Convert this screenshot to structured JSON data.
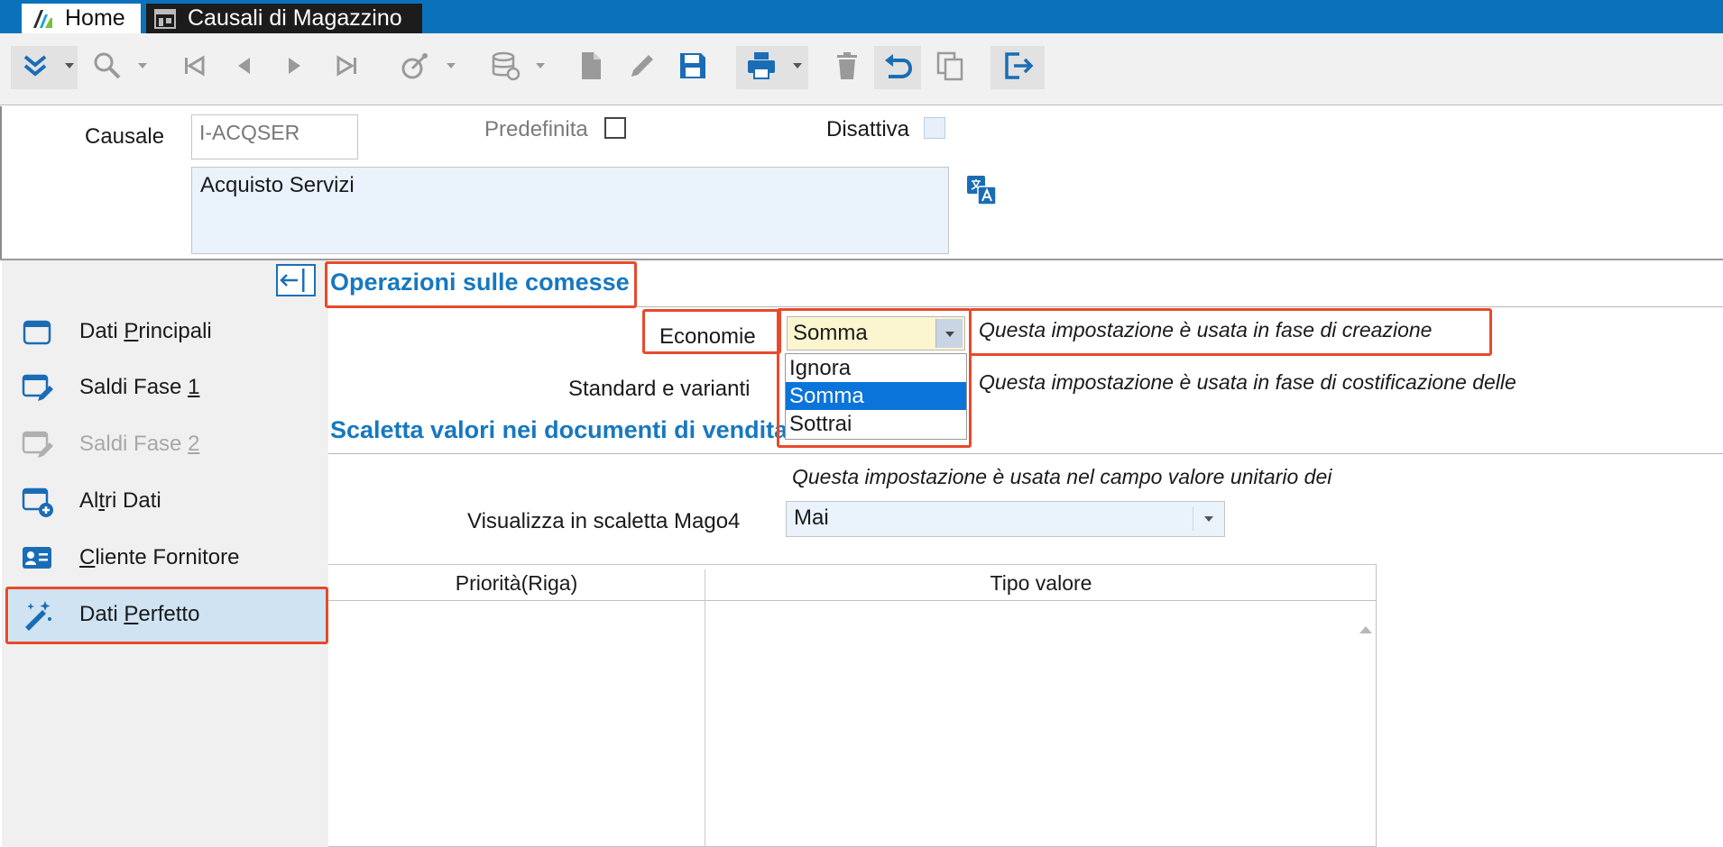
{
  "tabs": [
    {
      "label": "Home"
    },
    {
      "label": "Causali di Magazzino"
    }
  ],
  "form": {
    "causale_label": "Causale",
    "causale_value": "I-ACQSER",
    "predefinita_label": "Predefinita",
    "predefinita_checked": false,
    "disattiva_label": "Disattiva",
    "disattiva_checked": false,
    "description": "Acquisto Servizi"
  },
  "sidebar": {
    "items": [
      {
        "pre": "Dati ",
        "key": "P",
        "post": "rincipali",
        "icon": "card-icon",
        "state": "normal"
      },
      {
        "pre": "Saldi Fase ",
        "key": "1",
        "post": "",
        "icon": "edit-card-icon",
        "state": "normal"
      },
      {
        "pre": "Saldi Fase ",
        "key": "2",
        "post": "",
        "icon": "edit-card-icon",
        "state": "disabled"
      },
      {
        "pre": "Al",
        "key": "t",
        "post": "ri Dati",
        "icon": "add-card-icon",
        "state": "normal"
      },
      {
        "pre": "",
        "key": "C",
        "post": "liente Fornitore",
        "icon": "contact-card-icon",
        "state": "normal"
      },
      {
        "pre": "Dati ",
        "key": "P",
        "post": "erfetto",
        "icon": "magic-wand-icon",
        "state": "active"
      }
    ]
  },
  "main": {
    "section1_title": "Operazioni sulle comesse",
    "economie_label": "Economie",
    "economie_value": "Somma",
    "economie_hint": "Questa impostazione è usata in fase di creazione",
    "standard_label": "Standard e varianti",
    "standard_hint": "Questa impostazione è usata in fase di costificazione delle",
    "dropdown_options": [
      {
        "label": "Ignora",
        "selected": false
      },
      {
        "label": "Somma",
        "selected": true
      },
      {
        "label": "Sottrai",
        "selected": false
      }
    ],
    "section2_title": "Scaletta valori nei documenti di vendita",
    "scaletta_hint": "Questa impostazione è usata nel campo valore unitario dei",
    "scaletta_label": "Visualizza in scaletta Mago4",
    "scaletta_value": "Mai",
    "grid_headers": [
      "Priorità(Riga)",
      "Tipo valore"
    ]
  },
  "colors": {
    "accent": "#0a72bb",
    "section_title": "#1778bf",
    "highlight": "#e74a2b",
    "selected_option": "#0a74da"
  }
}
